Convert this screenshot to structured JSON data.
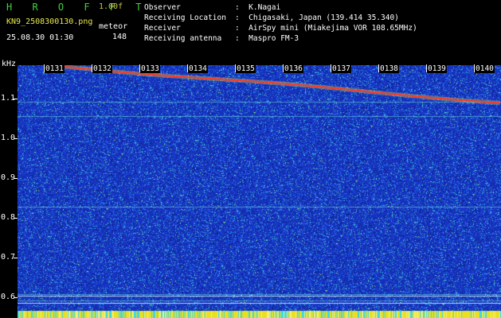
{
  "header": {
    "app_title": "H R O F F T",
    "version": "1.00f",
    "file_name": "KN9_2508300130.png",
    "meteor_label": "meteor",
    "meteor_count": "148",
    "timestamp": "25.08.30 01:30"
  },
  "info": [
    {
      "label": "Observer",
      "value": ":  K.Nagai"
    },
    {
      "label": "Receiving Location",
      "value": ":  Chigasaki, Japan (139.414 35.340)"
    },
    {
      "label": "Receiver",
      "value": ":  AirSpy mini (Miakejima VOR 108.65MHz)"
    },
    {
      "label": "Receiving antenna",
      "value": ":  Maspro FM-3"
    }
  ],
  "plot": {
    "y_unit": "kHz",
    "y_ticks": [
      "1.1",
      "1.0",
      "0.9",
      "0.8",
      "0.7",
      "0.6"
    ],
    "time_ticks": [
      "0131",
      "0132",
      "0133",
      "0134",
      "0135",
      "0136",
      "0137",
      "0138",
      "0139",
      "0140"
    ],
    "colors": {
      "background": "#1a3cc8",
      "trace": "#ff3a20",
      "speckle": "#46d6d8"
    }
  }
}
